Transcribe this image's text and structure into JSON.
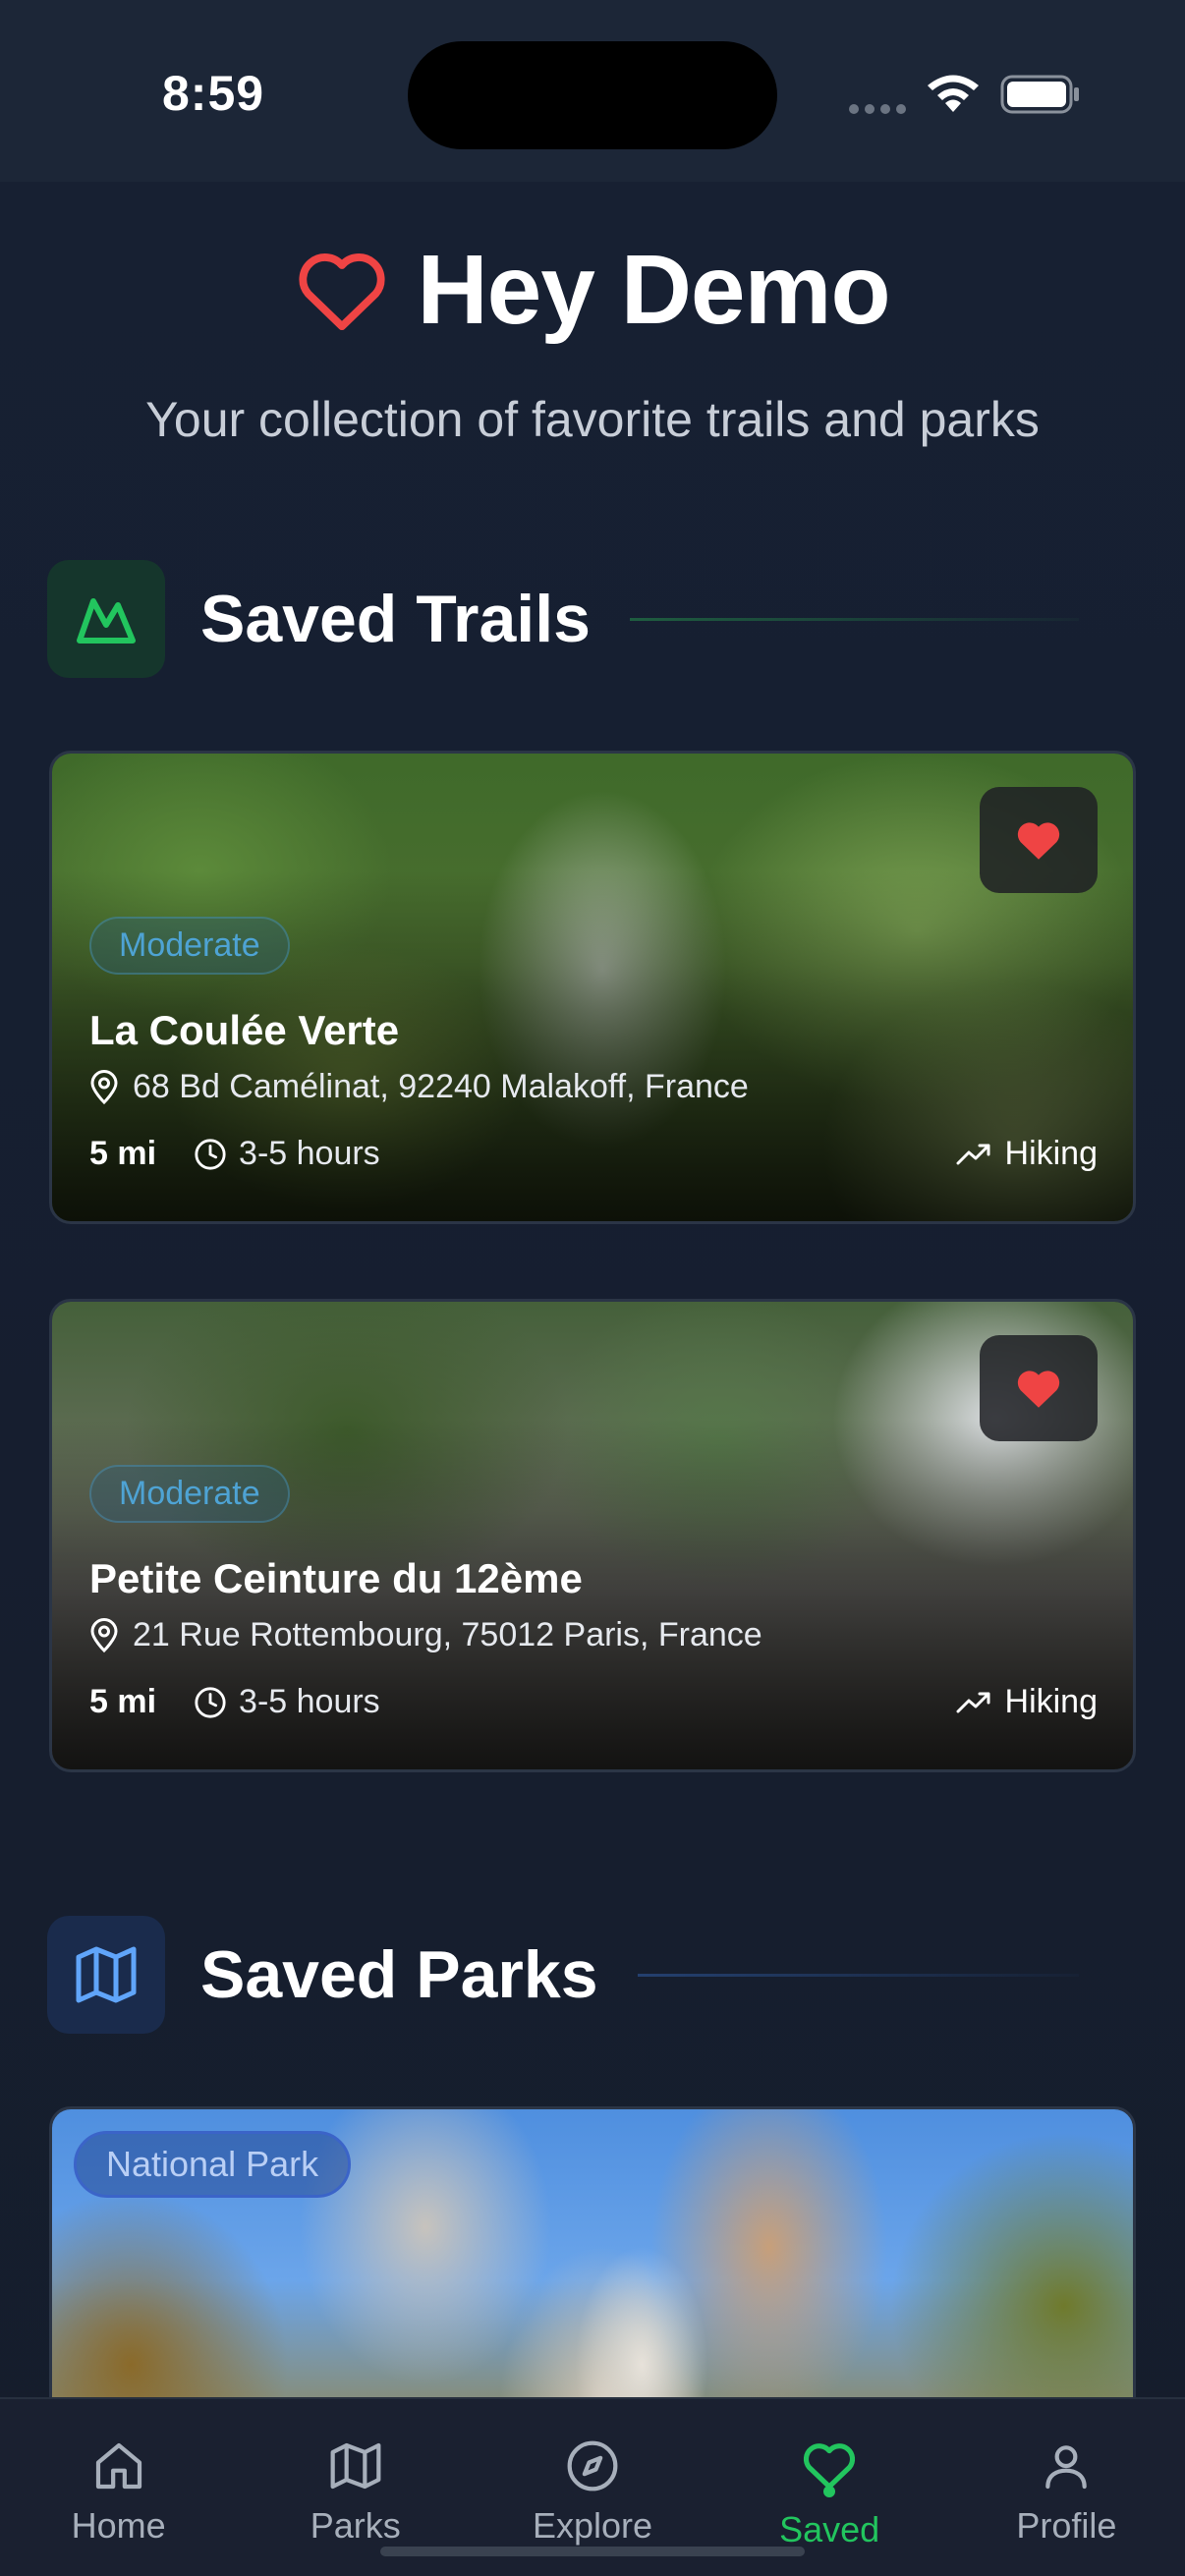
{
  "status_bar": {
    "time": "8:59"
  },
  "header": {
    "title": "Hey Demo",
    "subtitle": "Your collection of favorite trails and parks",
    "heart_color": "#ef4444"
  },
  "sections": {
    "trails": {
      "title": "Saved Trails",
      "icon": "mountain-icon",
      "accent": "#22c55e"
    },
    "parks": {
      "title": "Saved Parks",
      "icon": "map-icon",
      "accent": "#3b82f6"
    }
  },
  "trails": [
    {
      "difficulty": "Moderate",
      "name": "La Coulée Verte",
      "address": "68 Bd Camélinat, 92240 Malakoff, France",
      "distance": "5 mi",
      "duration": "3-5 hours",
      "type": "Hiking",
      "favorited": true
    },
    {
      "difficulty": "Moderate",
      "name": "Petite Ceinture du 12ème",
      "address": "21 Rue Rottembourg, 75012 Paris, France",
      "distance": "5 mi",
      "duration": "3-5 hours",
      "type": "Hiking",
      "favorited": true
    }
  ],
  "parks": [
    {
      "badge": "National Park"
    }
  ],
  "tabs": [
    {
      "label": "Home",
      "icon": "home-icon"
    },
    {
      "label": "Parks",
      "icon": "map-icon"
    },
    {
      "label": "Explore",
      "icon": "compass-icon"
    },
    {
      "label": "Saved",
      "icon": "heart-icon",
      "active": true
    },
    {
      "label": "Profile",
      "icon": "user-icon"
    }
  ],
  "colors": {
    "active_tab": "#22c55e",
    "favorite": "#ef4444",
    "difficulty": "#4ea3d4",
    "park_badge": "#3b64c8"
  }
}
